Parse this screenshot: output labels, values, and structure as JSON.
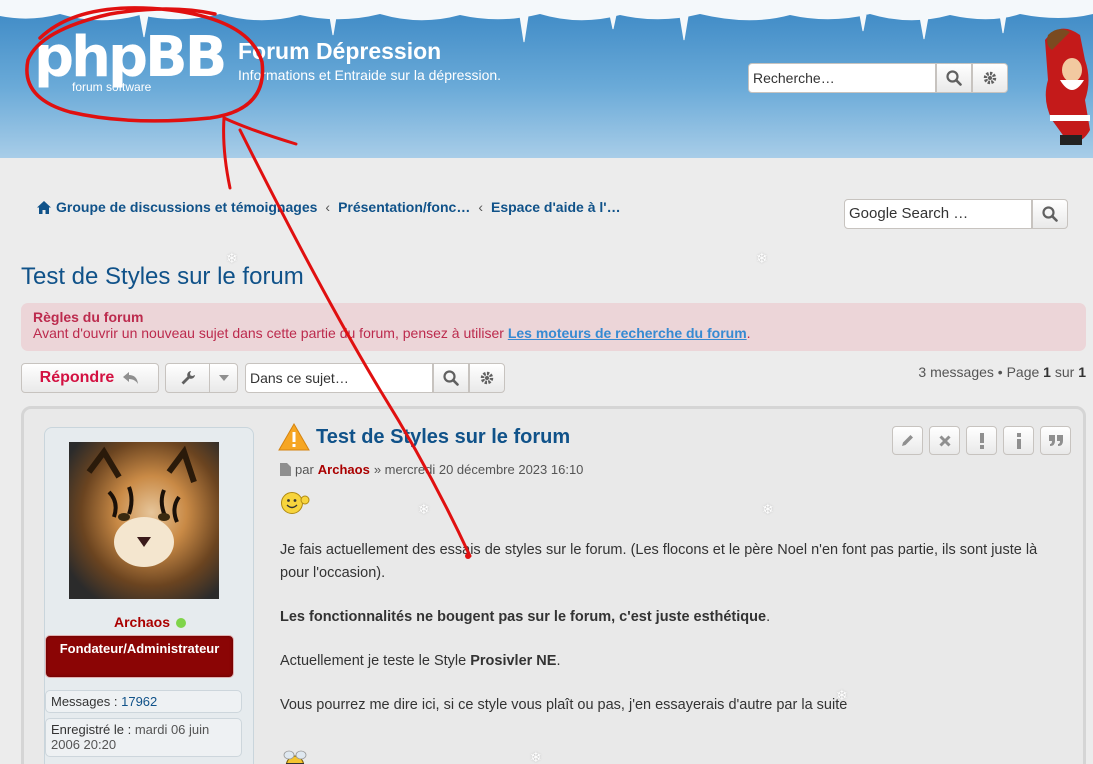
{
  "header": {
    "logo_text": "phpBB",
    "logo_subtext": "forum software",
    "site_title": "Forum Dépression",
    "site_description": "Informations et Entraide sur la dépression.",
    "search_placeholder": "Recherche…"
  },
  "breadcrumb": {
    "items": [
      "Groupe de discussions et témoignages",
      "Présentation/fonc…",
      "Espace d'aide à l'…"
    ],
    "separator": "‹"
  },
  "google_search": {
    "placeholder": "Google Search …"
  },
  "topic": {
    "title": "Test de Styles sur le forum"
  },
  "rules": {
    "title": "Règles du forum",
    "text": "Avant d'ouvrir un nouveau sujet dans cette partie du forum, pensez à utiliser ",
    "link": "Les moteurs de recherche du forum",
    "end": "."
  },
  "actions": {
    "reply_label": "Répondre",
    "topic_search_placeholder": "Dans ce sujet…"
  },
  "pagination": {
    "count_text": "3 messages • Page ",
    "page": "1",
    "of": " sur ",
    "total": "1"
  },
  "post": {
    "author": "Archaos",
    "rank": "Fondateur/Administrateur",
    "stats": {
      "messages_label": "Messages :",
      "messages_value": "17962",
      "registered_label": "Enregistré le :",
      "registered_value": "mardi 06 juin 2006 20:20"
    },
    "title": "Test de Styles sur le forum",
    "meta_by": "par",
    "meta_date": "» mercredi 20 décembre 2023 16:10",
    "paragraphs": [
      "Je fais actuellement des essais de styles sur le forum. (Les flocons et le père Noel n'en font pas partie, ils sont juste là pour l'occasion).",
      "Les fonctionnalités ne bougent pas sur le forum, c'est juste esthétique",
      "Actuellement je teste le Style ",
      "Vous pourrez me dire ici, si ce style vous plaît ou pas, j'en essayerais d'autre par la suite"
    ],
    "bold_end": ".",
    "style_name": "Prosivler NE",
    "style_end": "."
  },
  "colors": {
    "link": "#105289",
    "header_blue": "#3a87c4",
    "rules_bg": "#ecd5d8",
    "rules_text": "#bc2a4d",
    "reply_red": "#d31141",
    "rank_bg": "#8b0505",
    "annotation_red": "#e01010"
  }
}
